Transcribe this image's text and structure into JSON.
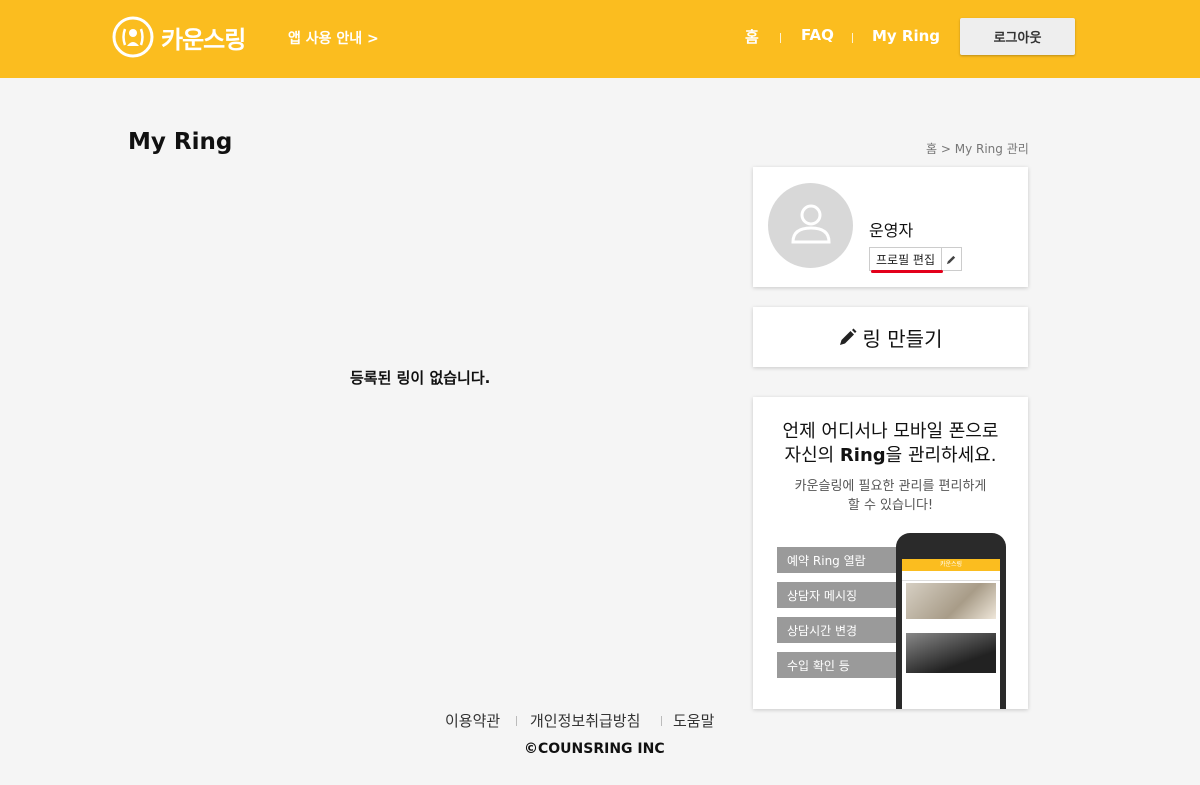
{
  "header": {
    "logo_text": "카운스링",
    "logo_icon": "counsring-logo-icon",
    "app_guide": "앱 사용 안내 >",
    "nav": {
      "home": "홈",
      "faq": "FAQ",
      "myring": "My Ring"
    },
    "logout_label": "로그아웃",
    "accent_color": "#fbbd1f"
  },
  "page": {
    "title": "My Ring",
    "breadcrumb": "홈 > My Ring 관리",
    "empty_message": "등록된 링이 없습니다."
  },
  "profile": {
    "name": "운영자",
    "edit_label": "프로필 편집",
    "avatar_icon": "user-silhouette-icon",
    "edit_icon": "pencil-icon"
  },
  "make_ring": {
    "label": "링 만들기",
    "icon": "pencil-icon"
  },
  "promo": {
    "line1": "언제 어디서나 모바일 폰으로",
    "line2_prefix": "자신의 ",
    "line2_bold": "Ring",
    "line2_suffix": "을 관리하세요.",
    "sub1": "카운슬링에 필요한 관리를 편리하게",
    "sub2": "할 수 있습니다!",
    "features": [
      "예약 Ring 열람",
      "상담자 메시징",
      "상담시간 변경",
      "수입 확인 등"
    ],
    "phone_title": "카운스링"
  },
  "footer": {
    "terms": "이용약관",
    "privacy": "개인정보취급방침",
    "help": "도움말",
    "copyright": "©COUNSRING INC"
  }
}
